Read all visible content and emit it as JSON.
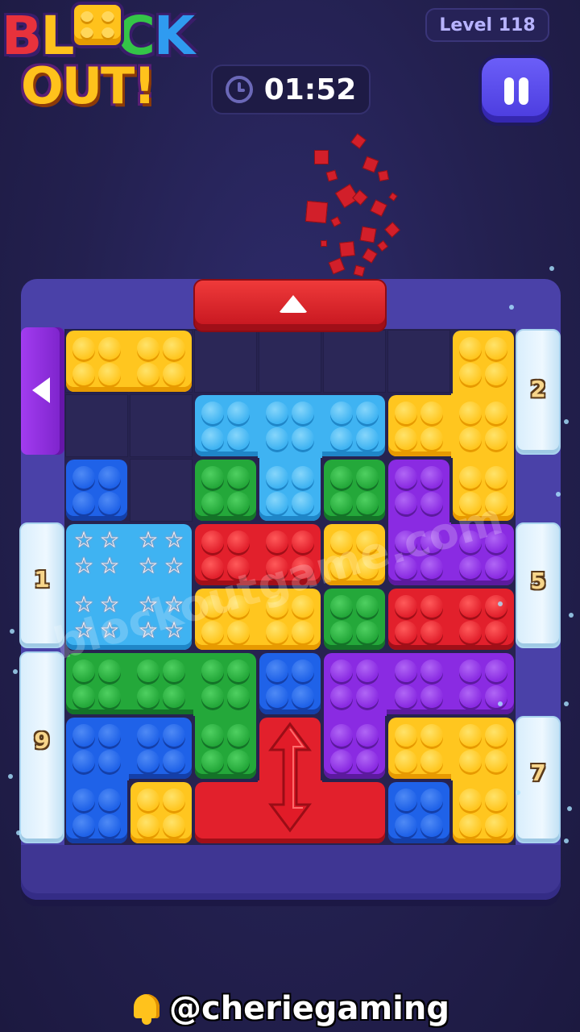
{
  "header": {
    "logo_top": "BLOCK",
    "logo_bottom": "OUT!",
    "level_label": "Level 118",
    "timer": "01:52"
  },
  "board": {
    "ice_counters": [
      "2",
      "1",
      "5",
      "9",
      "7"
    ]
  },
  "watermark": "blockoutgame.com",
  "footer": {
    "handle": "@cheriegaming"
  },
  "colors": {
    "yellow": "#ffc61f",
    "blue": "#1f62e8",
    "cyan": "#3fb3f2",
    "green": "#24a83a",
    "red": "#e2202c",
    "purple": "#8a2be2",
    "frame": "#4a41a8"
  }
}
